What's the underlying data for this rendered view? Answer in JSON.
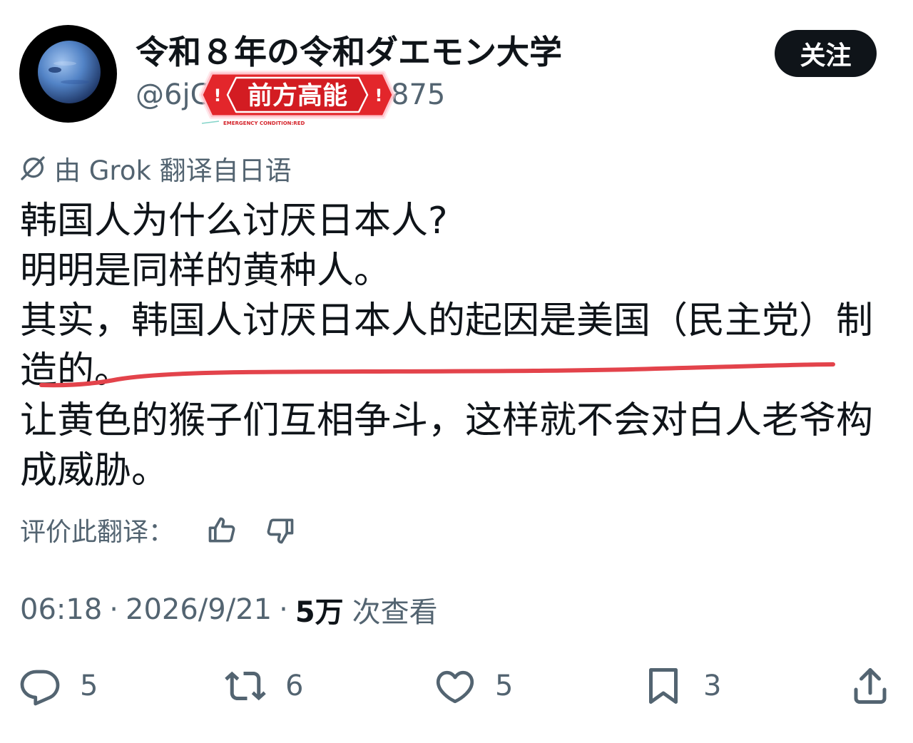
{
  "post": {
    "author": {
      "display_name": "令和８年の令和ダエモン大学",
      "handle_visible_start": "@6jG",
      "handle_visible_end": "875",
      "avatar_icon": "planet-avatar"
    },
    "follow_label": "关注",
    "sticker": {
      "left_mark": "!",
      "title": "前方高能",
      "right_mark": "!",
      "caption": "EMERGENCY CONDITION:RED"
    },
    "translation_note": {
      "icon": "grok-icon",
      "text": "由 Grok 翻译自日语"
    },
    "body_lines": [
      "韩国人为什么讨厌日本人?",
      "明明是同样的黄种人。",
      "其实，韩国人讨厌日本人的起因是美国（民主党）制",
      "造的。",
      "让黄色的猴子们互相争斗，这样就不会对白人老爷构",
      "成威胁。"
    ],
    "rate_translation": {
      "label": "评价此翻译：",
      "icons": [
        "thumbs-up-icon",
        "thumbs-down-icon"
      ]
    },
    "meta": {
      "time": "06:18",
      "separator": "·",
      "date": "2026/9/21",
      "views_count": "5万",
      "views_label": "次查看"
    },
    "actions": [
      {
        "icon": "reply-icon",
        "count": "5"
      },
      {
        "icon": "retweet-icon",
        "count": "6"
      },
      {
        "icon": "like-icon",
        "count": "5"
      },
      {
        "icon": "bookmark-icon",
        "count": "3"
      },
      {
        "icon": "share-icon"
      }
    ]
  },
  "colors": {
    "text_primary": "#0f1419",
    "text_secondary": "#536471",
    "follow_button_bg": "#0f1419",
    "sticker_red": "#e3262b",
    "annotation_red": "#e3434b"
  }
}
